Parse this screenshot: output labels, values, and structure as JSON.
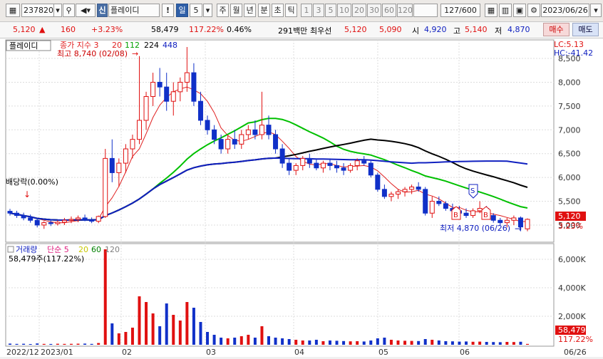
{
  "toolbar": {
    "code": "237820",
    "market_badge": "신",
    "name": "플레이디",
    "warning": "!",
    "period": "일",
    "period_num": "5",
    "periods": [
      "주",
      "월",
      "년",
      "분",
      "초",
      "틱"
    ],
    "numbers": [
      "1",
      "3",
      "5",
      "10",
      "20",
      "30",
      "60",
      "120"
    ],
    "count": "127",
    "count_max": "/600",
    "date": "2023/06/26"
  },
  "quote": {
    "price": "5,120",
    "arrow": "▲",
    "change": "160",
    "pct": "+3.23%",
    "volume": "58,479",
    "vol_ratio": "117.22%",
    "turnover": "0.46%",
    "amount": "291백만",
    "bid_label": "최우선",
    "ask": "5,120",
    "bid": "5,090",
    "open_label": "시",
    "open": "4,920",
    "high_label": "고",
    "high": "5,140",
    "low_label": "저",
    "low": "4,870",
    "buy_label": "매수",
    "sell_label": "매도"
  },
  "chart": {
    "name_tag": "플레이디",
    "legend_title": "종가 지수 3",
    "ma": [
      {
        "label": "20",
        "color": "#e02020"
      },
      {
        "label": "112",
        "color": "#00c000"
      },
      {
        "label": "224",
        "color": "#000000"
      },
      {
        "label": "448",
        "color": "#1020c0"
      }
    ],
    "high_note": "최고 8,740 (02/08)",
    "low_note": "최저 4,870 (06/26)",
    "left_note": "배당락(0.00%)",
    "lc_label": "LC:5.13",
    "hc_label": "HC:-41.42",
    "price_ticks": [
      "8,500",
      "8,000",
      "7,500",
      "7,000",
      "6,500",
      "6,000",
      "5,500",
      "5,000"
    ],
    "last_price": "5,120",
    "last_pct": "3.23%",
    "markers": {
      "sell": "S",
      "buy": "B"
    }
  },
  "volume_panel": {
    "title": "거래량",
    "simple": "단순 5",
    "ma": [
      {
        "label": "20",
        "color": "#c8c800"
      },
      {
        "label": "60",
        "color": "#008000"
      },
      {
        "label": "120",
        "color": "#808080"
      }
    ],
    "summary": "58,479주(117.22%)",
    "ticks": [
      "6,000K",
      "4,000K",
      "2,000K"
    ],
    "last": "58,479",
    "last_pct": "117.22%"
  },
  "xaxis": [
    "2022/12",
    "2023/01",
    "02",
    "03",
    "04",
    "05",
    "06",
    "06/26"
  ],
  "chart_data": {
    "type": "candlestick",
    "y_range": [
      4700,
      8800
    ],
    "candles": [
      [
        5290,
        5340,
        5200,
        5250
      ],
      [
        5250,
        5300,
        5150,
        5200
      ],
      [
        5200,
        5260,
        5100,
        5150
      ],
      [
        5150,
        5220,
        5050,
        5100
      ],
      [
        5100,
        5150,
        4950,
        5000
      ],
      [
        5000,
        5080,
        4920,
        5050
      ],
      [
        5050,
        5120,
        4980,
        5030
      ],
      [
        5030,
        5100,
        4990,
        5060
      ],
      [
        5060,
        5150,
        5000,
        5100
      ],
      [
        5100,
        5180,
        5040,
        5120
      ],
      [
        5120,
        5200,
        5060,
        5150
      ],
      [
        5150,
        5220,
        5080,
        5100
      ],
      [
        5100,
        5160,
        5040,
        5080
      ],
      [
        5080,
        5200,
        5040,
        5180
      ],
      [
        5180,
        6600,
        5150,
        6400
      ],
      [
        6400,
        6800,
        5900,
        6100
      ],
      [
        6100,
        6400,
        5800,
        6300
      ],
      [
        6300,
        6700,
        6100,
        6600
      ],
      [
        6600,
        6900,
        6400,
        6800
      ],
      [
        6800,
        8550,
        6700,
        7200
      ],
      [
        7200,
        7800,
        7000,
        7700
      ],
      [
        7700,
        8200,
        7500,
        8000
      ],
      [
        8000,
        8300,
        7700,
        7900
      ],
      [
        7900,
        8200,
        7400,
        7600
      ],
      [
        7600,
        8000,
        7300,
        7800
      ],
      [
        7800,
        8100,
        7600,
        8000
      ],
      [
        8000,
        8740,
        7800,
        8200
      ],
      [
        8200,
        8400,
        7500,
        7600
      ],
      [
        7600,
        7800,
        7100,
        7200
      ],
      [
        7200,
        7300,
        6900,
        7000
      ],
      [
        7000,
        7100,
        6700,
        6800
      ],
      [
        6800,
        6900,
        6500,
        6600
      ],
      [
        6600,
        6900,
        6500,
        6800
      ],
      [
        6800,
        7000,
        6600,
        6700
      ],
      [
        6700,
        7000,
        6600,
        6900
      ],
      [
        6900,
        7100,
        6800,
        7000
      ],
      [
        7000,
        7200,
        6800,
        6900
      ],
      [
        6900,
        7800,
        6800,
        7100
      ],
      [
        7100,
        7300,
        6800,
        6900
      ],
      [
        6900,
        7000,
        6500,
        6600
      ],
      [
        6600,
        6700,
        6200,
        6300
      ],
      [
        6300,
        6400,
        6050,
        6150
      ],
      [
        6150,
        6300,
        6050,
        6250
      ],
      [
        6250,
        6450,
        6150,
        6400
      ],
      [
        6400,
        6500,
        6200,
        6300
      ],
      [
        6300,
        6400,
        6150,
        6200
      ],
      [
        6200,
        6350,
        6100,
        6300
      ],
      [
        6300,
        6400,
        6150,
        6250
      ],
      [
        6250,
        6350,
        6100,
        6200
      ],
      [
        6200,
        6300,
        6050,
        6150
      ],
      [
        6150,
        6300,
        6100,
        6250
      ],
      [
        6250,
        6400,
        6150,
        6350
      ],
      [
        6350,
        6450,
        6250,
        6300
      ],
      [
        6300,
        6350,
        6000,
        6050
      ],
      [
        6050,
        6100,
        5700,
        5750
      ],
      [
        5750,
        5850,
        5550,
        5600
      ],
      [
        5600,
        5700,
        5500,
        5650
      ],
      [
        5650,
        5750,
        5550,
        5700
      ],
      [
        5700,
        5800,
        5600,
        5750
      ],
      [
        5750,
        5850,
        5650,
        5800
      ],
      [
        5800,
        5900,
        5700,
        5750
      ],
      [
        5750,
        5800,
        5200,
        5250
      ],
      [
        5250,
        5600,
        5150,
        5500
      ],
      [
        5500,
        5600,
        5400,
        5450
      ],
      [
        5450,
        5500,
        5300,
        5350
      ],
      [
        5350,
        5450,
        5250,
        5300
      ],
      [
        5300,
        5400,
        5200,
        5250
      ],
      [
        5250,
        5350,
        5150,
        5200
      ],
      [
        5200,
        5350,
        5150,
        5300
      ],
      [
        5300,
        5500,
        5250,
        5350
      ],
      [
        5350,
        5400,
        5150,
        5200
      ],
      [
        5200,
        5250,
        5050,
        5100
      ],
      [
        5100,
        5150,
        5000,
        5050
      ],
      [
        5050,
        5150,
        4950,
        5100
      ],
      [
        5100,
        5200,
        5000,
        5150
      ],
      [
        5150,
        5180,
        4870,
        4960
      ],
      [
        4920,
        5140,
        4870,
        5120
      ]
    ],
    "volumes": [
      80,
      60,
      70,
      50,
      90,
      60,
      55,
      70,
      60,
      65,
      75,
      80,
      60,
      120,
      6700,
      1500,
      800,
      900,
      1200,
      3400,
      3000,
      2200,
      1300,
      2900,
      2100,
      1700,
      3000,
      2600,
      1600,
      900,
      700,
      500,
      450,
      500,
      600,
      700,
      500,
      1300,
      600,
      500,
      450,
      400,
      350,
      300,
      300,
      350,
      250,
      300,
      280,
      260,
      240,
      250,
      230,
      300,
      450,
      500,
      350,
      300,
      280,
      270,
      260,
      400,
      350,
      300,
      250,
      240,
      220,
      230,
      210,
      220,
      200,
      190,
      180,
      200,
      190,
      210,
      58
    ],
    "vol_range": [
      0,
      7000
    ]
  }
}
